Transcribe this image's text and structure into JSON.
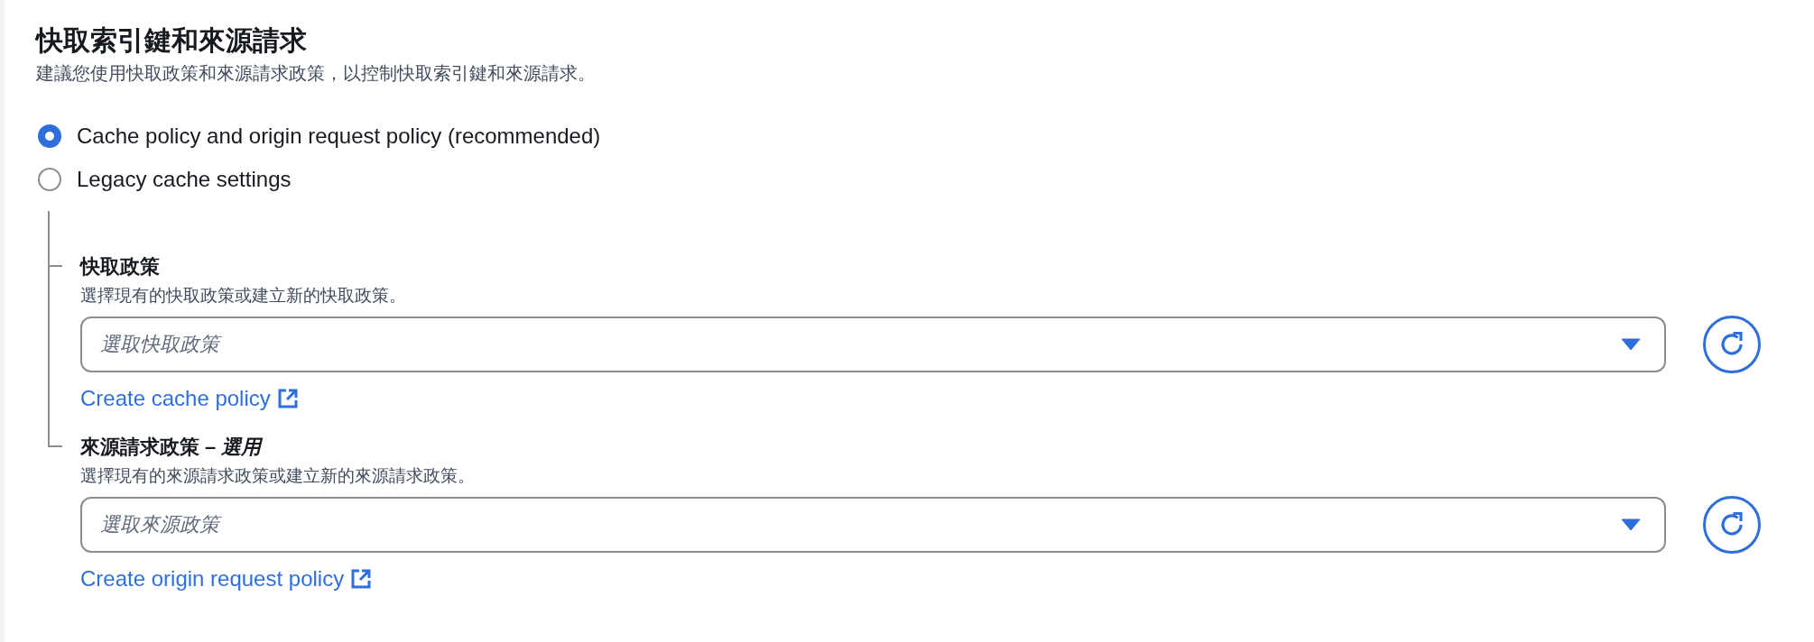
{
  "heading": "快取索引鍵和來源請求",
  "description": "建議您使用快取政策和來源請求政策，以控制快取索引鍵和來源請求。",
  "options": [
    {
      "label": "Cache policy and origin request policy (recommended)",
      "selected": true
    },
    {
      "label": "Legacy cache settings",
      "selected": false
    }
  ],
  "sections": [
    {
      "label": "快取政策",
      "description": "選擇現有的快取政策或建立新的快取政策。",
      "select": {
        "placeholder": "選取快取政策"
      },
      "link": "Create cache policy"
    },
    {
      "label": "來源請求政策 – *選用*",
      "description": "選擇現有的來源請求政策或建立新的來源請求政策。",
      "select": {
        "placeholder": "選取來源政策"
      },
      "link": "Create origin request policy"
    }
  ]
}
